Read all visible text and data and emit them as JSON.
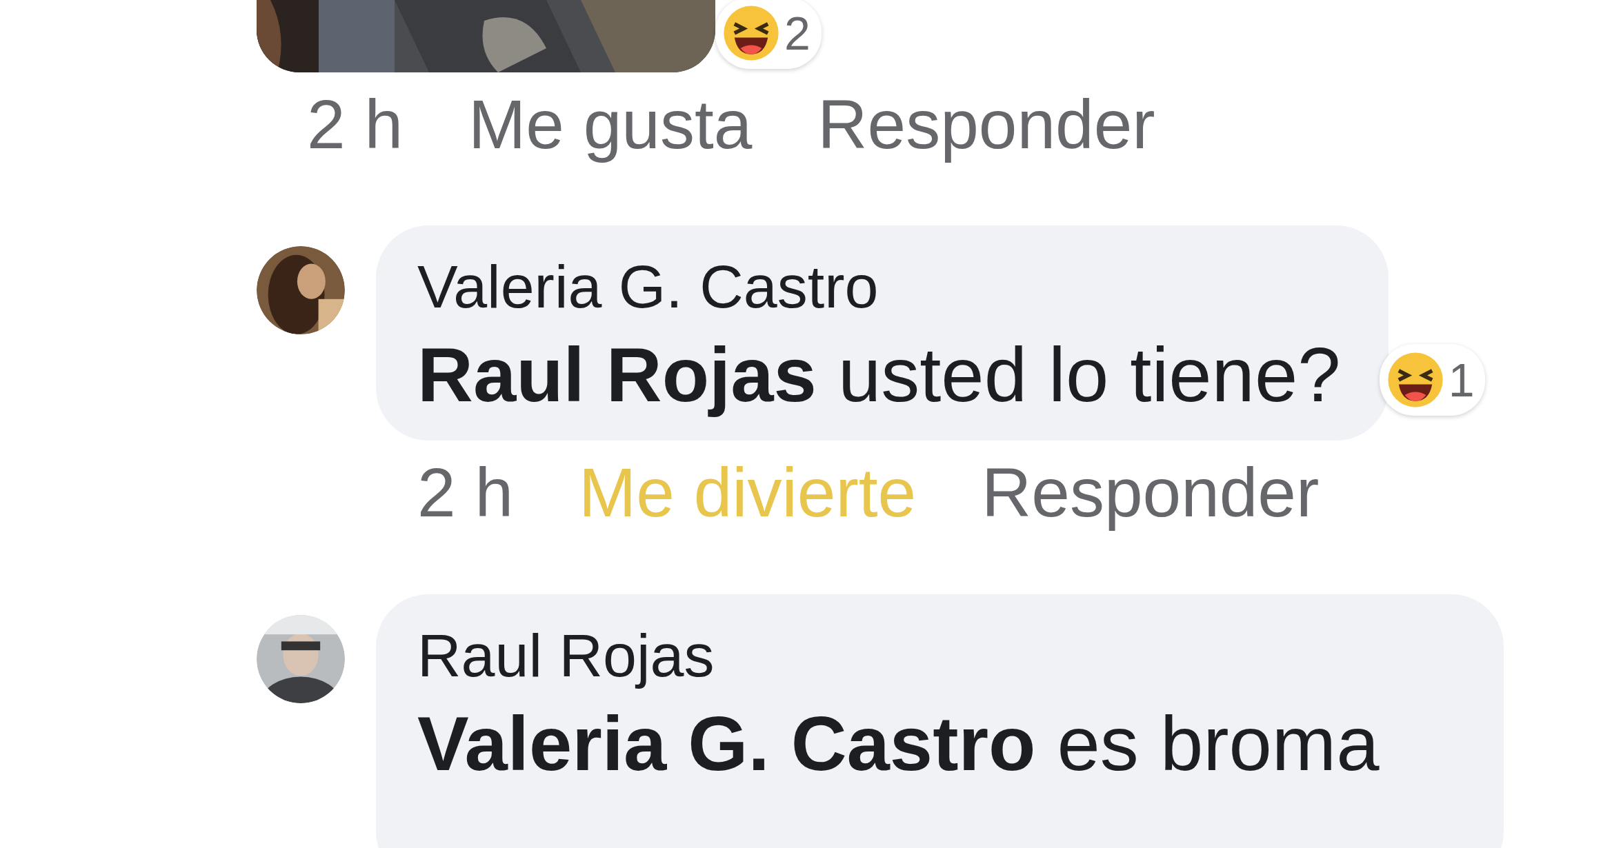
{
  "comments": [
    {
      "reaction_count": "2",
      "time": "2 h",
      "reaction": {
        "label": "Me gusta",
        "reacted": false
      },
      "reply": "Responder"
    },
    {
      "kind": "text",
      "author": "Valeria G. Castro",
      "text": "**Raul Rojas**  usted lo tiene?",
      "reaction_count": "1",
      "time": "2 h",
      "reaction": {
        "label": "Me divierte",
        "reacted": true
      },
      "reply": "Responder"
    },
    {
      "kind": "text",
      "author": "Raul Rojas",
      "text": "**Valeria G. Castro** es broma"
    }
  ]
}
